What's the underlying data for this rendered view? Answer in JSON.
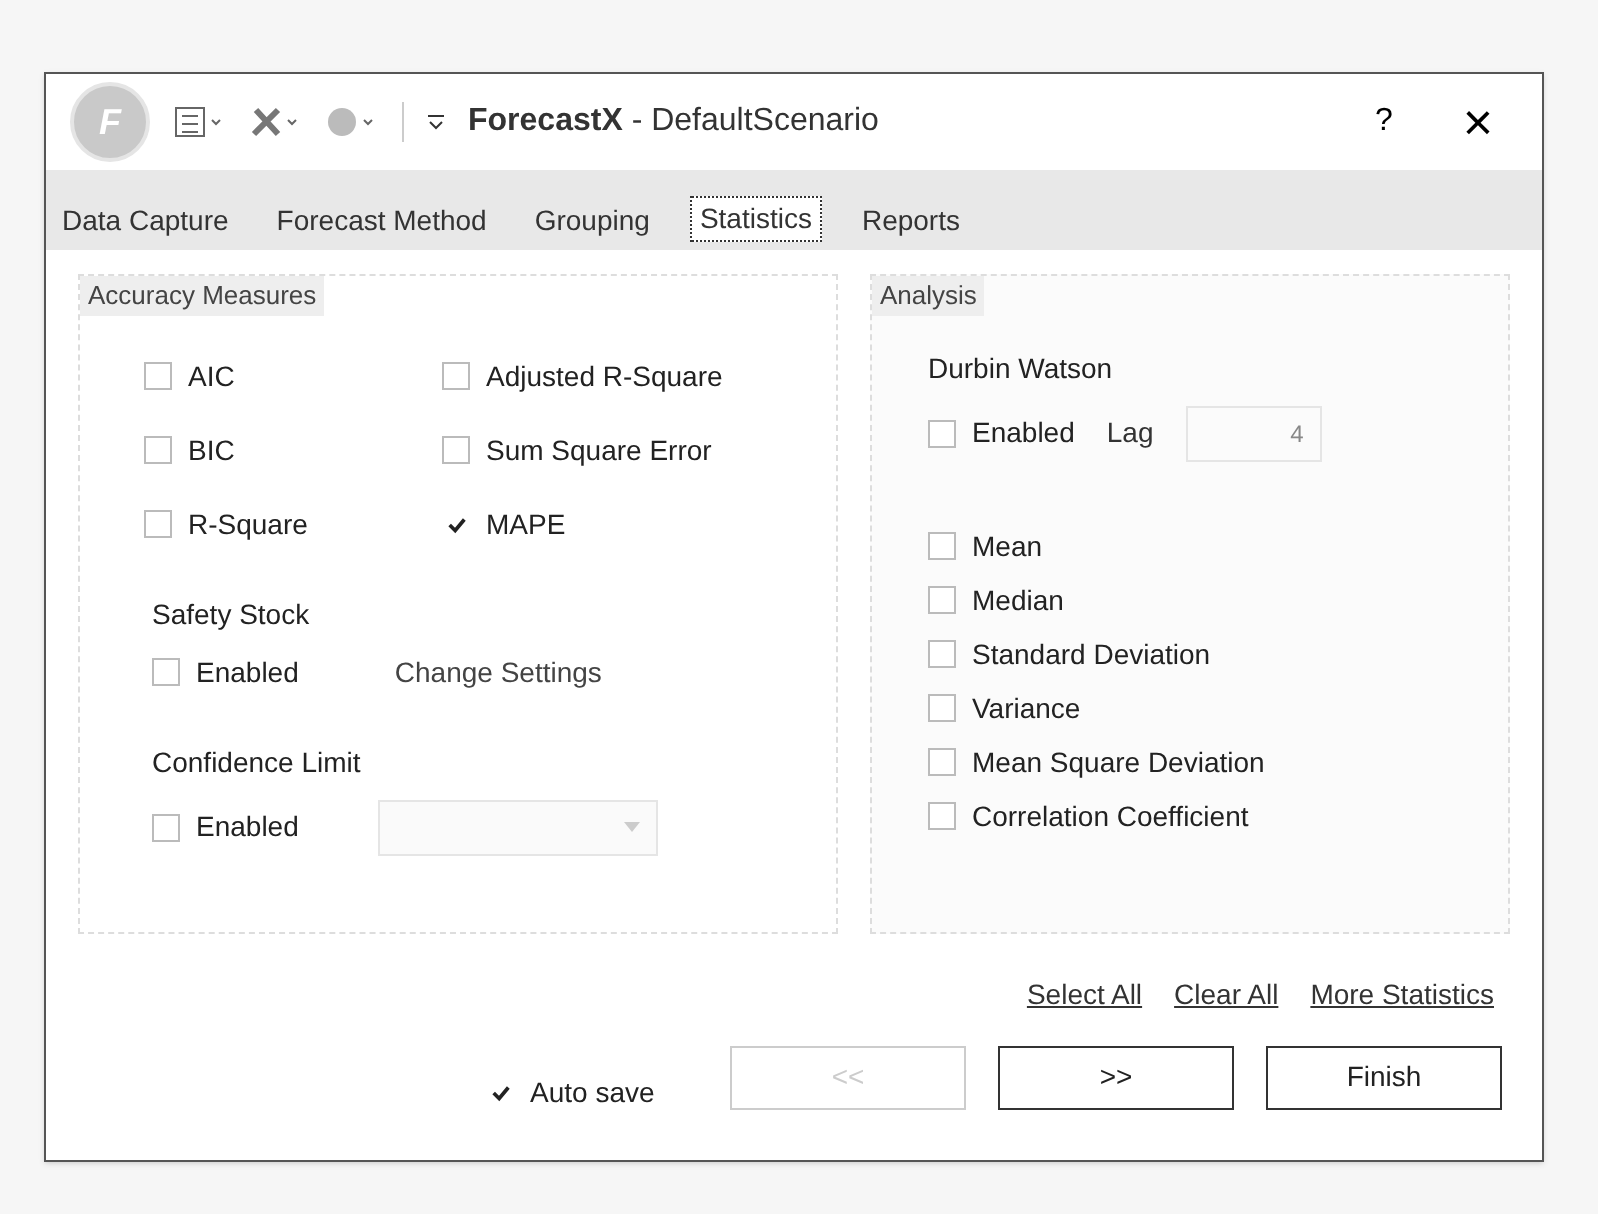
{
  "window": {
    "logo_letter": "F",
    "title_app": "ForecastX",
    "title_rest": " - DefaultScenario",
    "help": "?",
    "close": "×"
  },
  "tabs": [
    {
      "label": "Data Capture",
      "selected": false
    },
    {
      "label": "Forecast Method",
      "selected": false
    },
    {
      "label": "Grouping",
      "selected": false
    },
    {
      "label": "Statistics",
      "selected": true
    },
    {
      "label": "Reports",
      "selected": false
    }
  ],
  "accuracy": {
    "title": "Accuracy Measures",
    "items": [
      {
        "label": "AIC",
        "checked": false
      },
      {
        "label": "Adjusted R-Square",
        "checked": false
      },
      {
        "label": "BIC",
        "checked": false
      },
      {
        "label": "Sum Square Error",
        "checked": false
      },
      {
        "label": "R-Square",
        "checked": false
      },
      {
        "label": "MAPE",
        "checked": true
      }
    ]
  },
  "safety_stock": {
    "title": "Safety Stock",
    "enabled_label": "Enabled",
    "enabled": false,
    "link": "Change Settings"
  },
  "confidence_limit": {
    "title": "Confidence Limit",
    "enabled_label": "Enabled",
    "enabled": false,
    "dropdown_disabled": true
  },
  "analysis": {
    "title": "Analysis",
    "durbin_title": "Durbin Watson",
    "enabled_label": "Enabled",
    "enabled": false,
    "lag_label": "Lag",
    "lag_value": "4",
    "items": [
      {
        "label": "Mean",
        "checked": false
      },
      {
        "label": "Median",
        "checked": false
      },
      {
        "label": "Standard Deviation",
        "checked": false
      },
      {
        "label": "Variance",
        "checked": false
      },
      {
        "label": "Mean Square Deviation",
        "checked": false
      },
      {
        "label": "Correlation Coefficient",
        "checked": false
      }
    ]
  },
  "links": [
    "Select All",
    "Clear All",
    "More Statistics"
  ],
  "auto_save": {
    "label": "Auto save",
    "checked": true
  },
  "buttons": [
    {
      "label": "<<",
      "disabled": true
    },
    {
      "label": ">>",
      "disabled": false
    },
    {
      "label": "Finish",
      "disabled": false
    }
  ]
}
